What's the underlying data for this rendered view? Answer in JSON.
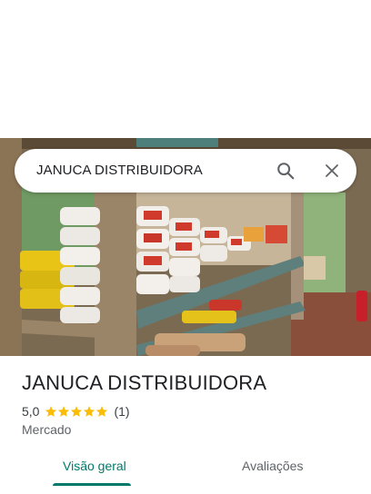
{
  "search": {
    "query": "JANUCA DISTRIBUIDORA",
    "search_icon": "search-icon",
    "close_icon": "close-icon"
  },
  "place": {
    "name": "JANUCA DISTRIBUIDORA",
    "rating_value": "5,0",
    "stars": 5,
    "review_count": "(1)",
    "category": "Mercado"
  },
  "tabs": [
    {
      "label": "Visão geral",
      "active": true
    },
    {
      "label": "Avaliações",
      "active": false
    }
  ],
  "colors": {
    "accent": "#00796b",
    "star": "#fbbc04",
    "text_primary": "#202124",
    "text_secondary": "#5f6368"
  }
}
